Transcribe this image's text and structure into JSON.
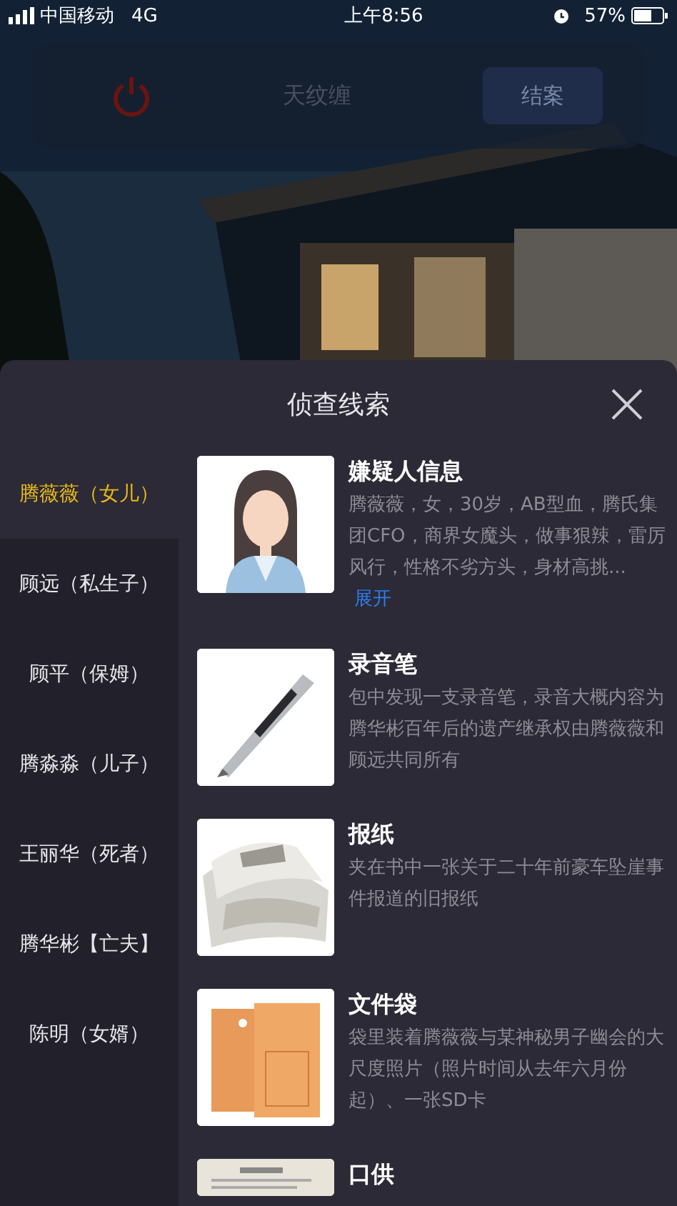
{
  "status_bar": {
    "carrier": "中国移动",
    "network": "4G",
    "time": "上午8:56",
    "battery": "57%"
  },
  "case_bar": {
    "name": "天纹缠",
    "close_case": "结案"
  },
  "sheet": {
    "title": "侦查线索"
  },
  "suspects": [
    {
      "label": "腾薇薇（女儿）",
      "selected": true
    },
    {
      "label": "顾远（私生子）",
      "selected": false
    },
    {
      "label": "顾平（保姆）",
      "selected": false
    },
    {
      "label": "腾淼淼（儿子）",
      "selected": false
    },
    {
      "label": "王丽华（死者）",
      "selected": false
    },
    {
      "label": "腾华彬【亡夫】",
      "selected": false
    },
    {
      "label": "陈明（女婿）",
      "selected": false
    }
  ],
  "clues": [
    {
      "kind": "person",
      "title": "嫌疑人信息",
      "text": "腾薇薇，女，30岁，AB型血，腾氏集团CFO，商界女魔头，做事狠辣，雷厉风行，性格不劣方头，身材高挑...",
      "more": "展开"
    },
    {
      "kind": "pen",
      "title": "录音笔",
      "text": "包中发现一支录音笔，录音大概内容为腾华彬百年后的遗产继承权由腾薇薇和顾远共同所有"
    },
    {
      "kind": "newspaper",
      "title": "报纸",
      "text": "夹在书中一张关于二十年前豪车坠崖事件报道的旧报纸"
    },
    {
      "kind": "envelope",
      "title": "文件袋",
      "text": "袋里装着腾薇薇与某神秘男子幽会的大尺度照片（照片时间从去年六月份起）、一张SD卡"
    },
    {
      "kind": "document",
      "title": "口供"
    }
  ]
}
